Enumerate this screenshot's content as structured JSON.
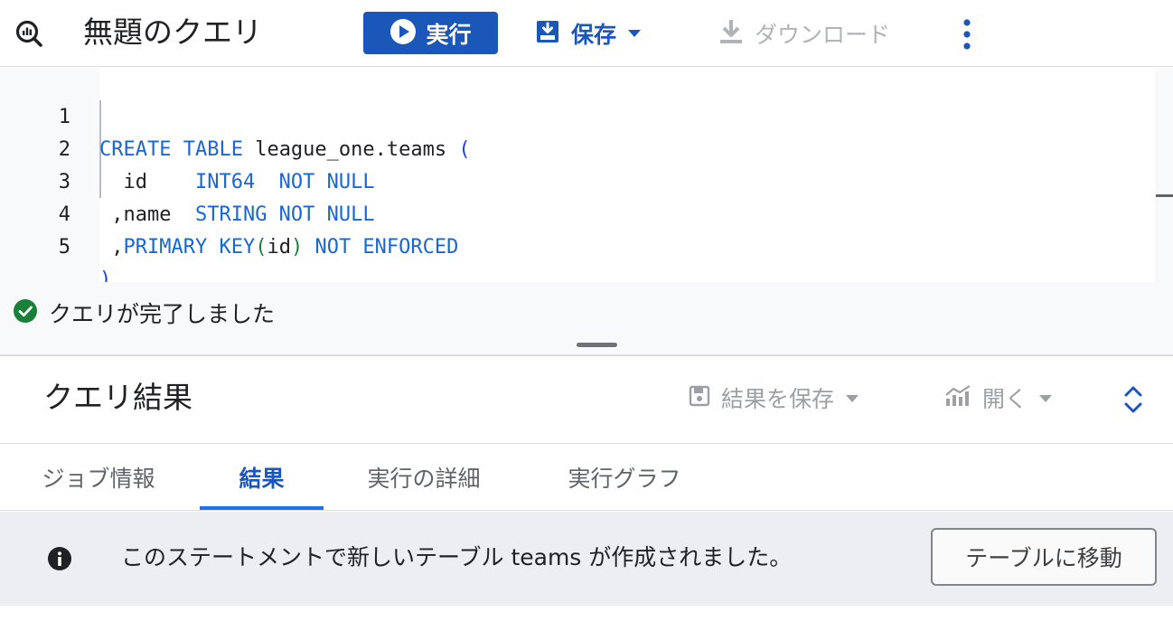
{
  "toolbar": {
    "title": "無題のクエリ",
    "run_label": "実行",
    "save_label": "保存",
    "download_label": "ダウンロード"
  },
  "editor": {
    "line_numbers": [
      "1",
      "2",
      "3",
      "4",
      "5"
    ],
    "lines": [
      [
        {
          "t": "CREATE TABLE",
          "c": "kw"
        },
        {
          "t": " league_one.teams ",
          "c": "id"
        },
        {
          "t": "(",
          "c": "pn"
        }
      ],
      [
        {
          "t": "  id    ",
          "c": "id"
        },
        {
          "t": "INT64  NOT NULL",
          "c": "kw"
        }
      ],
      [
        {
          "t": " ,name  ",
          "c": "id"
        },
        {
          "t": "STRING NOT NULL",
          "c": "kw"
        }
      ],
      [
        {
          "t": " ,",
          "c": "id"
        },
        {
          "t": "PRIMARY KEY",
          "c": "kw"
        },
        {
          "t": "(",
          "c": "pg"
        },
        {
          "t": "id",
          "c": "id"
        },
        {
          "t": ")",
          "c": "pg"
        },
        {
          "t": " NOT ENFORCED",
          "c": "kw"
        }
      ],
      [
        {
          "t": ")",
          "c": "pn"
        }
      ]
    ]
  },
  "status": {
    "message": "クエリが完了しました"
  },
  "results": {
    "title": "クエリ結果",
    "save_results_label": "結果を保存",
    "open_label": "開く"
  },
  "tabs": [
    {
      "label": "ジョブ情報"
    },
    {
      "label": "結果"
    },
    {
      "label": "実行の詳細"
    },
    {
      "label": "実行グラフ"
    }
  ],
  "banner": {
    "message": "このステートメントで新しいテーブル teams が作成されました。",
    "button_label": "テーブルに移動"
  },
  "colors": {
    "primary": "#1a57b8",
    "keyword": "#1967d2",
    "success": "#188038",
    "disabled": "#9aa0a6"
  }
}
